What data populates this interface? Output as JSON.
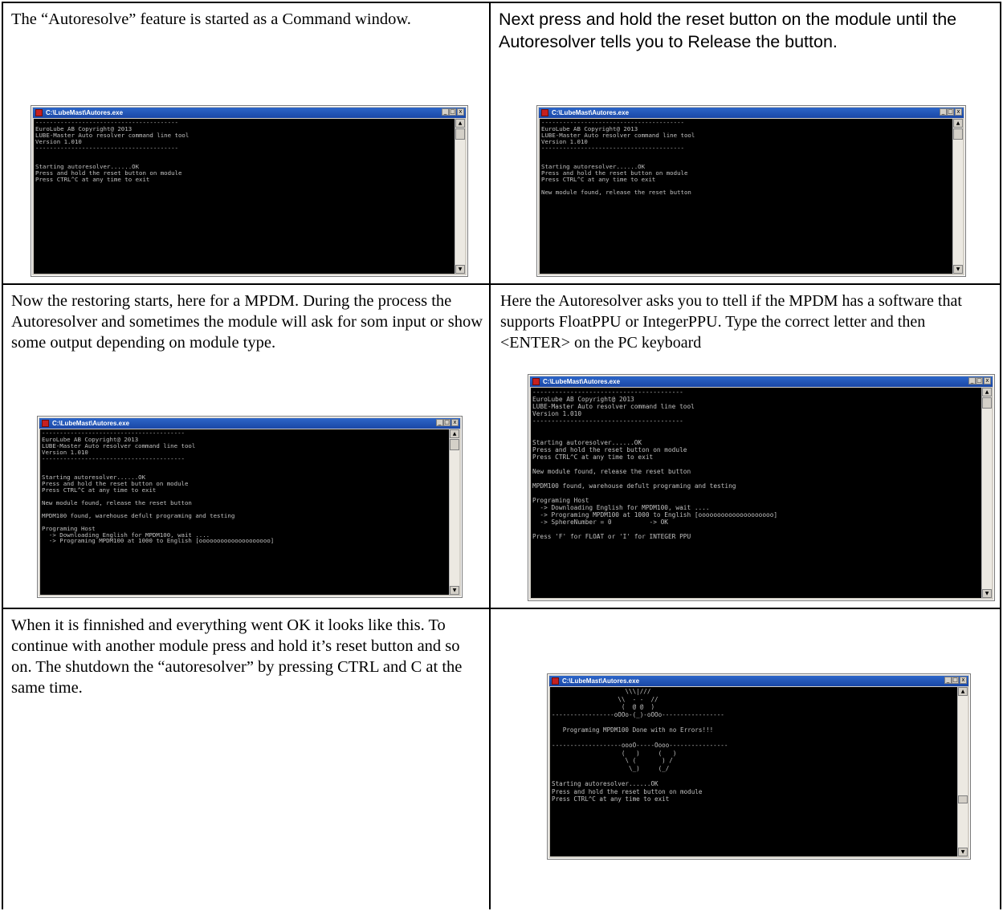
{
  "cells": {
    "step1": "The “Autoresolve” feature is started as a Command window.",
    "step2": "Next press and hold the reset button on the module until the Autoresolver tells you to Release the button.",
    "step3": "Now the restoring starts, here for a MPDM. During the process the Autoresolver and sometimes the module will ask for som input or show some output depending on module type.",
    "step4": "Here the Autoresolver asks you to ttell if the MPDM has a software that supports FloatPPU or IntegerPPU. Type the correct letter and then <ENTER> on the PC keyboard",
    "step5": "When it is finnished and everything went OK it looks like this. To continue with another module press and hold it’s reset button and so on. The shutdown the “autoresolver” by pressing CTRL and C at the same time."
  },
  "window": {
    "title": "C:\\LubeMast\\Autores.exe",
    "minimize": "_",
    "maximize": "□",
    "close": "x",
    "scroll_up": "▲",
    "scroll_down": "▼"
  },
  "consoles": {
    "c1": "----------------------------------------\nEuroLube AB Copyright@ 2013\nLUBE-Master Auto resolver command line tool\nVersion 1.010\n----------------------------------------\n\n\nStarting autoresolver......OK\nPress and hold the reset button on module\nPress CTRL^C at any time to exit",
    "c2": "----------------------------------------\nEuroLube AB Copyright@ 2013\nLUBE-Master Auto resolver command line tool\nVersion 1.010\n----------------------------------------\n\n\nStarting autoresolver......OK\nPress and hold the reset button on module\nPress CTRL^C at any time to exit\n\nNew module found, release the reset button",
    "c3": "----------------------------------------\nEuroLube AB Copyright@ 2013\nLUBE-Master Auto resolver command line tool\nVersion 1.010\n----------------------------------------\n\n\nStarting autoresolver......OK\nPress and hold the reset button on module\nPress CTRL^C at any time to exit\n\nNew module found, release the reset button\n\nMPDM100 found, warehouse defult programing and testing\n\nPrograming Host\n  -> Downloading English for MPDM100, wait ....\n  -> Programing MPDM100 at 1000 to English [oooooooooooooooooooo]",
    "c4": "----------------------------------------\nEuroLube AB Copyright@ 2013\nLUBE-Master Auto resolver command line tool\nVersion 1.010\n----------------------------------------\n\n\nStarting autoresolver......OK\nPress and hold the reset button on module\nPress CTRL^C at any time to exit\n\nNew module found, release the reset button\n\nMPDM100 found, warehouse defult programing and testing\n\nPrograming Host\n  -> Downloading English for MPDM100, wait ....\n  -> Programing MPDM100 at 1000 to English [oooooooooooooooooooo]\n  -> SphereNumber = 0          -> OK\n\nPress 'F' for FLOAT or 'I' for INTEGER PPU",
    "c5": "                    \\\\\\|///\n                  \\\\  - -  //\n                   (  @ @  )\n-----------------oOOo-(_)-oOOo-----------------\n\n   Programing MPDM100 Done with no Errors!!!\n\n-------------------oooO-----Oooo----------------\n                   (   )     (   )\n                    \\ (       ) /\n                     \\_)     (_/\n\nStarting autoresolver......OK\nPress and hold the reset button on module\nPress CTRL^C at any time to exit"
  }
}
